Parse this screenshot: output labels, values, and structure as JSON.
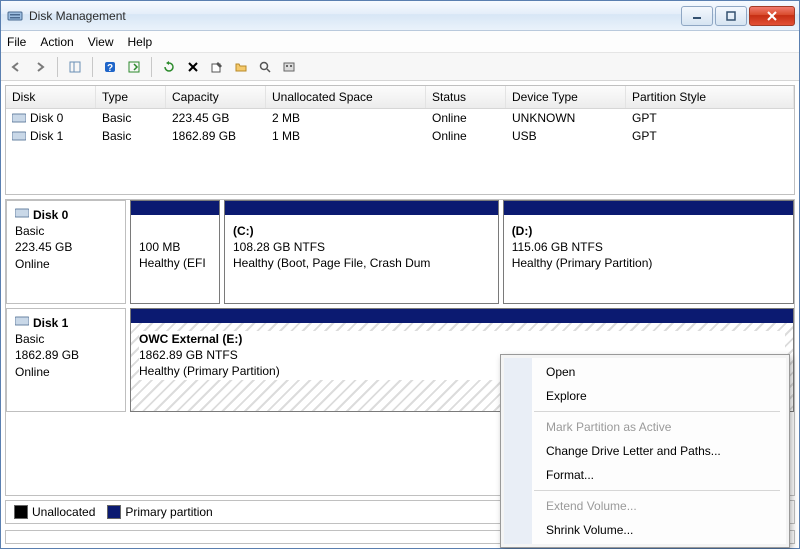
{
  "window": {
    "title": "Disk Management"
  },
  "menu": {
    "file": "File",
    "action": "Action",
    "view": "View",
    "help": "Help"
  },
  "columns": {
    "disk": "Disk",
    "type": "Type",
    "capacity": "Capacity",
    "unallocated": "Unallocated Space",
    "status": "Status",
    "device": "Device Type",
    "pstyle": "Partition Style"
  },
  "disks": [
    {
      "name": "Disk 0",
      "type": "Basic",
      "capacity": "223.45 GB",
      "unallocated": "2 MB",
      "status": "Online",
      "device": "UNKNOWN",
      "pstyle": "GPT"
    },
    {
      "name": "Disk 1",
      "type": "Basic",
      "capacity": "1862.89 GB",
      "unallocated": "1 MB",
      "status": "Online",
      "device": "USB",
      "pstyle": "GPT"
    }
  ],
  "graphical": {
    "disk0": {
      "header": {
        "name": "Disk 0",
        "type": "Basic",
        "size": "223.45 GB",
        "status": "Online"
      },
      "p0": {
        "size": "100 MB",
        "status": "Healthy (EFI"
      },
      "p1": {
        "name": "(C:)",
        "size": "108.28 GB NTFS",
        "status": "Healthy (Boot, Page File, Crash Dum"
      },
      "p2": {
        "name": "(D:)",
        "size": "115.06 GB NTFS",
        "status": "Healthy (Primary Partition)"
      }
    },
    "disk1": {
      "header": {
        "name": "Disk 1",
        "type": "Basic",
        "size": "1862.89 GB",
        "status": "Online"
      },
      "p0": {
        "name": "OWC External  (E:)",
        "size": "1862.89 GB NTFS",
        "status": "Healthy (Primary Partition)"
      }
    }
  },
  "legend": {
    "unallocated": "Unallocated",
    "primary": "Primary partition"
  },
  "context_menu": {
    "open": "Open",
    "explore": "Explore",
    "mark_active": "Mark Partition as Active",
    "change_letter": "Change Drive Letter and Paths...",
    "format": "Format...",
    "extend": "Extend Volume...",
    "shrink": "Shrink Volume..."
  }
}
